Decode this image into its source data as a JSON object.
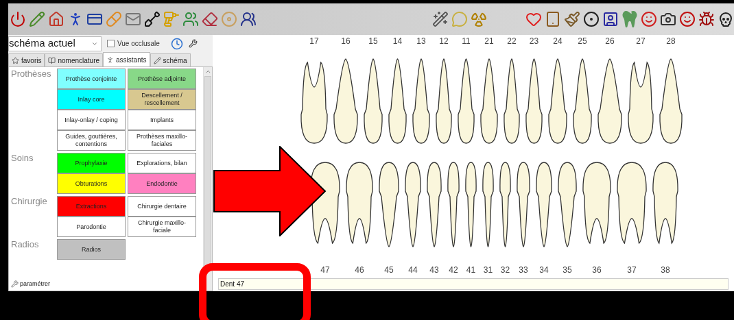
{
  "view_select": {
    "value": "schéma actuel"
  },
  "occlusal_checkbox": {
    "label": "Vue occlusale",
    "checked": false
  },
  "tabs": [
    {
      "label": "favoris",
      "selected": false
    },
    {
      "label": "nomenclature",
      "selected": false
    },
    {
      "label": "assistants",
      "selected": true
    },
    {
      "label": "schéma",
      "selected": false
    }
  ],
  "groups": [
    {
      "label": "Prothèses",
      "rows": [
        [
          {
            "label": "Prothèse conjointe",
            "color": "#80ffff"
          },
          {
            "label": "Prothèse adjointe",
            "color": "#88d888"
          }
        ],
        [
          {
            "label": "Inlay core",
            "color": "#00ffff"
          },
          {
            "label": "Descellement / rescellement",
            "color": "#d8c890"
          }
        ],
        [
          {
            "label": "Inlay-onlay / coping",
            "color": "#ffffff"
          },
          {
            "label": "Implants",
            "color": "#ffffff"
          }
        ],
        [
          {
            "label": "Guides, gouttières, contentions",
            "color": "#ffffff"
          },
          {
            "label": "Prothèses maxillo-faciales",
            "color": "#ffffff"
          }
        ]
      ]
    },
    {
      "label": "Soins",
      "rows": [
        [
          {
            "label": "Prophylaxie",
            "color": "#00ff00"
          },
          {
            "label": "Explorations, bilan",
            "color": "#ffffff"
          }
        ],
        [
          {
            "label": "Obturations",
            "color": "#ffff00"
          },
          {
            "label": "Endodontie",
            "color": "#ff80c0"
          }
        ]
      ]
    },
    {
      "label": "Chirurgie",
      "rows": [
        [
          {
            "label": "Extractions",
            "color": "#ff0000"
          },
          {
            "label": "Chirurgie dentaire",
            "color": "#ffffff"
          }
        ],
        [
          {
            "label": "Parodontie",
            "color": "#ffffff"
          },
          {
            "label": "Chirurgie maxillo-faciale",
            "color": "#ffffff"
          }
        ]
      ]
    },
    {
      "label": "Radios",
      "rows": [
        [
          {
            "label": "Radios",
            "color": "#c0c0c0"
          }
        ]
      ]
    }
  ],
  "settings_link": "paramétrer",
  "upper_teeth": [
    "17",
    "16",
    "15",
    "14",
    "13",
    "12",
    "11",
    "21",
    "22",
    "23",
    "24",
    "25",
    "26",
    "27",
    "28"
  ],
  "lower_teeth": [
    "47",
    "46",
    "45",
    "44",
    "43",
    "42",
    "41",
    "31",
    "32",
    "33",
    "34",
    "35",
    "36",
    "37",
    "38"
  ],
  "status_bar": "Dent 47"
}
